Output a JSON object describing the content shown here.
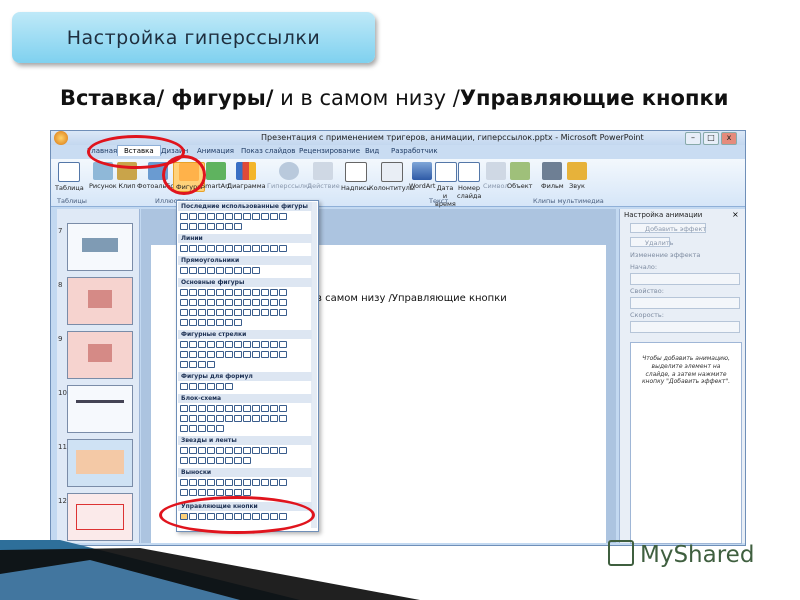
{
  "slide": {
    "title": "Настройка гиперссылки",
    "subtitle_a": "Вставка/ фигуры/",
    "subtitle_b": " и в самом низу /",
    "subtitle_c": "Управляющие кнопки"
  },
  "window": {
    "title": "Презентация с применением тригеров, анимации, гиперссылок.pptx - Microsoft PowerPoint",
    "minimize": "–",
    "maximize": "□",
    "close": "x"
  },
  "ribbon_tabs": [
    "Главная",
    "Вставка",
    "Дизайн",
    "Анимация",
    "Показ слайдов",
    "Рецензирование",
    "Вид",
    "Разработчик"
  ],
  "ribbon_buttons": [
    {
      "label": "Таблица",
      "icon": "table-icon"
    },
    {
      "label": "Рисунок",
      "icon": "picture-icon"
    },
    {
      "label": "Клип",
      "icon": "clip-icon"
    },
    {
      "label": "Фотоальбом",
      "icon": "photo-album-icon"
    },
    {
      "label": "Фигуры",
      "icon": "shapes-icon"
    },
    {
      "label": "SmartArt",
      "icon": "smartart-icon"
    },
    {
      "label": "Диаграмма",
      "icon": "chart-icon"
    },
    {
      "label": "Гиперссылка",
      "icon": "hyperlink-icon"
    },
    {
      "label": "Действие",
      "icon": "action-icon"
    },
    {
      "label": "Надпись",
      "icon": "textbox-icon"
    },
    {
      "label": "Колонтитулы",
      "icon": "header-footer-icon"
    },
    {
      "label": "WordArt",
      "icon": "wordart-icon"
    },
    {
      "label": "Дата и время",
      "icon": "date-time-icon"
    },
    {
      "label": "Номер слайда",
      "icon": "slide-number-icon"
    },
    {
      "label": "Символ",
      "icon": "symbol-icon"
    },
    {
      "label": "Объект",
      "icon": "object-icon"
    },
    {
      "label": "Фильм",
      "icon": "movie-icon"
    },
    {
      "label": "Звук",
      "icon": "sound-icon"
    }
  ],
  "ribbon_groups": [
    "Таблицы",
    "Иллюстрации",
    "Текст",
    "Клипы мультимедиа"
  ],
  "thumbnails": [
    "7",
    "8",
    "9",
    "10",
    "11",
    "12"
  ],
  "slide_canvas_text": "в самом низу /Управляющие кнопки",
  "shapes_sections": [
    "Последние использованные фигуры",
    "Линии",
    "Прямоугольники",
    "Основные фигуры",
    "Фигурные стрелки",
    "Фигуры для формул",
    "Блок-схема",
    "Звезды и ленты",
    "Выноски",
    "Управляющие кнопки"
  ],
  "anim_pane": {
    "title": "Настройка анимации",
    "add_effect": "Добавить эффект",
    "remove": "Удалить",
    "change_effect": "Изменение эффекта",
    "start": "Начало:",
    "property": "Свойство:",
    "speed": "Скорость:",
    "hint": "Чтобы добавить анимацию, выделите элемент на слайде, а затем нажмите кнопку \"Добавить эффект\"."
  },
  "watermark": "MyShared",
  "colors": {
    "highlight": "#e0141d",
    "pill": "#7fd1ef",
    "ribbon": "#d6e6f8"
  }
}
